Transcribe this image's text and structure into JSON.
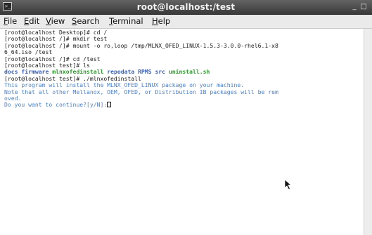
{
  "window": {
    "title": "root@localhost:/test",
    "minimize_glyph": "_",
    "maximize_glyph": "□",
    "app_icon_glyph": ">_"
  },
  "menubar": {
    "items": [
      {
        "label": "File",
        "mnemonic": "F",
        "rest": "ile"
      },
      {
        "label": "Edit",
        "mnemonic": "E",
        "rest": "dit"
      },
      {
        "label": "View",
        "mnemonic": "V",
        "rest": "iew"
      },
      {
        "label": "Search",
        "mnemonic": "S",
        "rest": "earch"
      },
      {
        "label": "Terminal",
        "mnemonic": "T",
        "rest": "erminal"
      },
      {
        "label": "Help",
        "mnemonic": "H",
        "rest": "elp"
      }
    ]
  },
  "terminal": {
    "lines": [
      "[root@localhost Desktop]# cd /",
      "[root@localhost /]# mkdir test",
      "[root@localhost /]# mount -o ro,loop /tmp/MLNX_OFED_LINUX-1.5.3-3.0.0-rhel6.1-x8",
      "6_64.iso /test",
      "[root@localhost /]# cd /test",
      "[root@localhost test]# ls"
    ],
    "ls_output": [
      {
        "name": "docs",
        "kind": "dir"
      },
      {
        "name": "firmware",
        "kind": "dir"
      },
      {
        "name": "mlnxofedinstall",
        "kind": "exec"
      },
      {
        "name": "repodata",
        "kind": "dir"
      },
      {
        "name": "RPMS",
        "kind": "dir"
      },
      {
        "name": "src",
        "kind": "dir"
      },
      {
        "name": "uninstall.sh",
        "kind": "exec"
      }
    ],
    "lines_after": [
      "[root@localhost test]# ./mlnxofedinstall"
    ],
    "messages": [
      "This program will install the MLNX_OFED_LINUX package on your machine.",
      "Note that all other Mellanox, OEM, OFED, or Distribution IB packages will be rem",
      "oved."
    ],
    "prompt": "Do you want to continue?[y/N]:"
  },
  "colors": {
    "message_text": "#4d80c8",
    "ls_directory": "#3a5fb8",
    "ls_executable": "#2e9a2e",
    "command_text": "#202020"
  }
}
